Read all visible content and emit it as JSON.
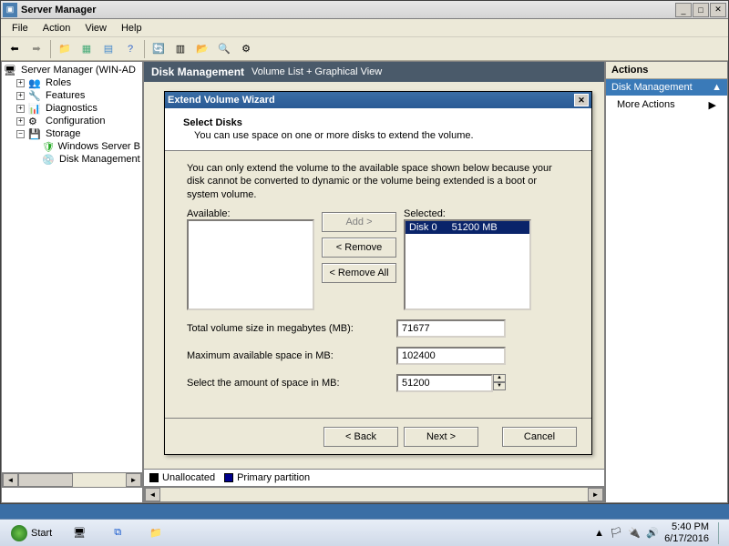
{
  "window": {
    "title": "Server Manager"
  },
  "menubar": [
    "File",
    "Action",
    "View",
    "Help"
  ],
  "tree": {
    "root": "Server Manager (WIN-AD",
    "items": [
      "Roles",
      "Features",
      "Diagnostics",
      "Configuration",
      "Storage"
    ],
    "storage_children": [
      "Windows Server B",
      "Disk Management"
    ]
  },
  "dm": {
    "title": "Disk Management",
    "subtitle": "Volume List + Graphical View"
  },
  "actions": {
    "header": "Actions",
    "section": "Disk Management",
    "more": "More Actions"
  },
  "legend": {
    "unalloc": "Unallocated",
    "primary": "Primary partition"
  },
  "wizard": {
    "title": "Extend Volume Wizard",
    "heading": "Select Disks",
    "subheading": "You can use space on one or more disks to extend the volume.",
    "note": "You can only extend the volume to the available space shown below because your disk cannot be converted to dynamic or the volume being extended is a boot or system volume.",
    "available_label": "Available:",
    "selected_label": "Selected:",
    "add": "Add >",
    "remove": "< Remove",
    "remove_all": "< Remove All",
    "selected": [
      {
        "disk": "Disk 0",
        "size": "51200 MB"
      }
    ],
    "total_label": "Total volume size in megabytes (MB):",
    "total_value": "71677",
    "max_label": "Maximum available space in MB:",
    "max_value": "102400",
    "amount_label": "Select the amount of space in MB:",
    "amount_value": "51200",
    "back": "< Back",
    "next": "Next >",
    "cancel": "Cancel"
  },
  "taskbar": {
    "start": "Start",
    "time": "5:40 PM",
    "date": "6/17/2016"
  }
}
